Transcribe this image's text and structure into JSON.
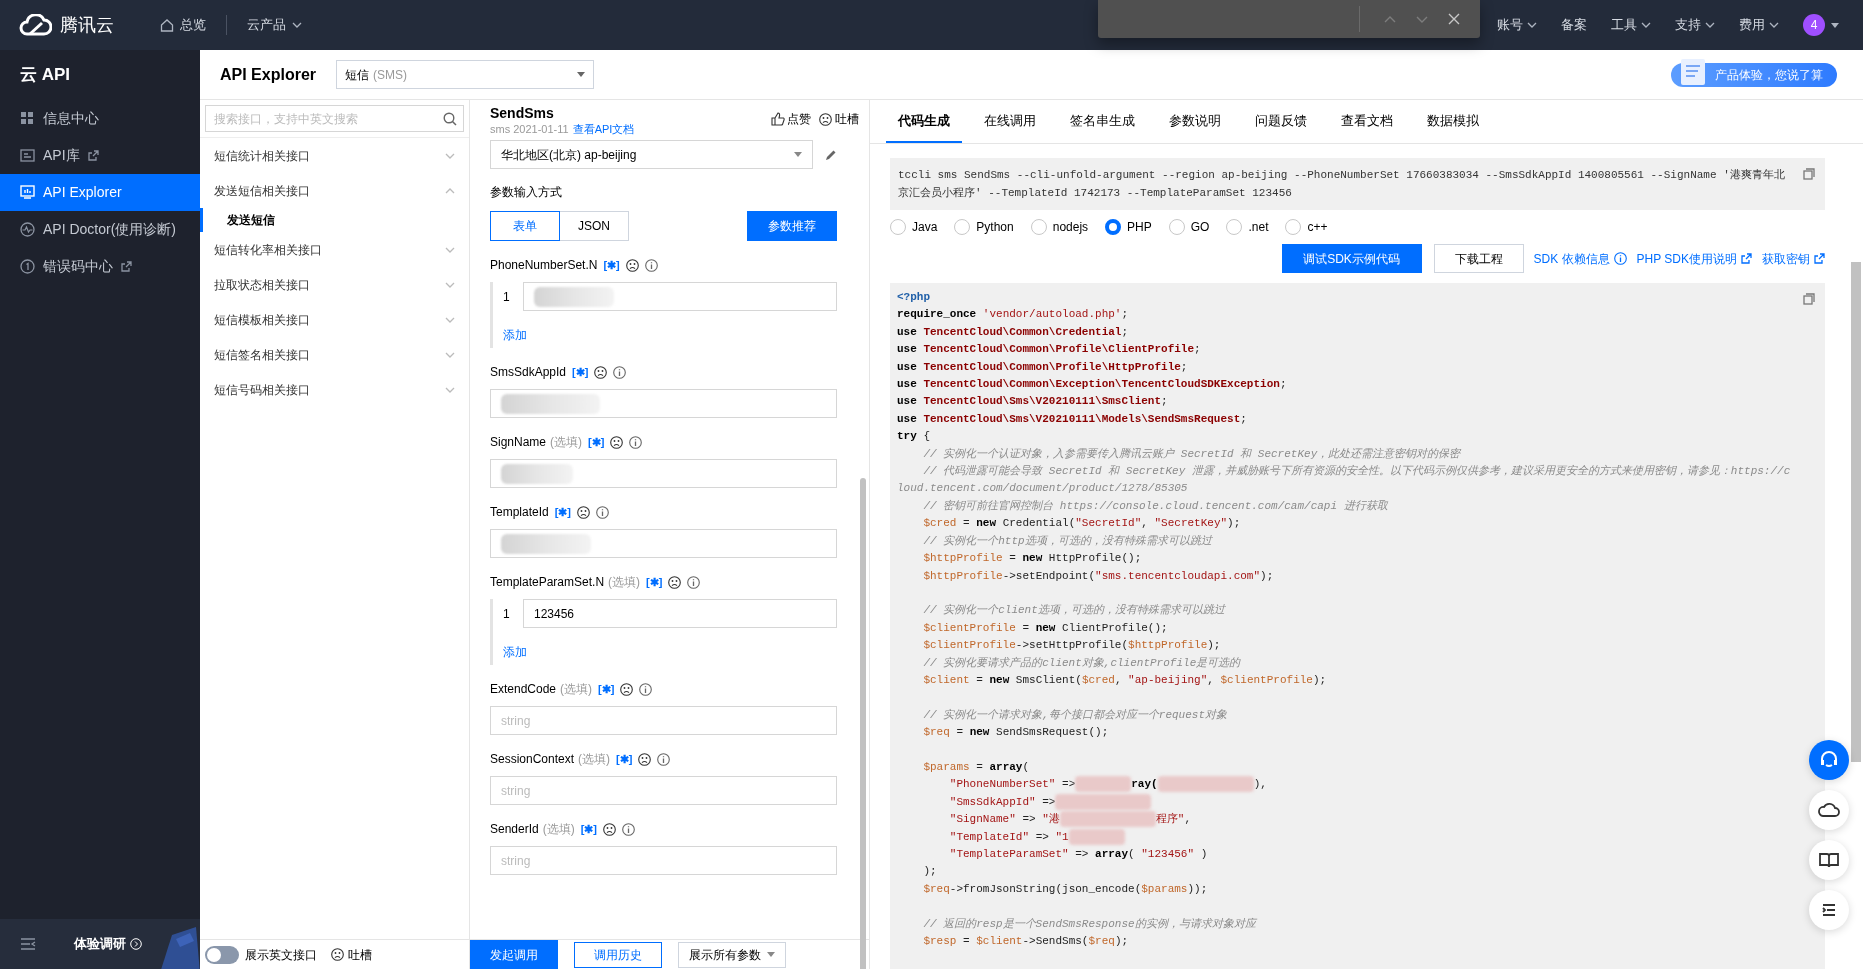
{
  "topnav": {
    "logo": "腾讯云",
    "links": [
      {
        "label": "总览",
        "kind": "home"
      },
      {
        "label": "云产品",
        "kind": "menu"
      }
    ],
    "right": [
      {
        "label": "账号",
        "kind": "menu"
      },
      {
        "label": "备案",
        "kind": "plain"
      },
      {
        "label": "工具",
        "kind": "menu"
      },
      {
        "label": "支持",
        "kind": "menu"
      },
      {
        "label": "费用",
        "kind": "menu"
      }
    ],
    "avatar": "4"
  },
  "find_bar": {
    "shown": true
  },
  "sidebar": {
    "title": "云 API",
    "items": [
      {
        "label": "信息中心",
        "external": false,
        "selected": false
      },
      {
        "label": "API库",
        "external": true,
        "selected": false
      },
      {
        "label": "API Explorer",
        "external": false,
        "selected": true
      },
      {
        "label": "API Doctor(使用诊断)",
        "external": false,
        "selected": false
      },
      {
        "label": "错误码中心",
        "external": true,
        "selected": false
      }
    ],
    "survey": "体验调研"
  },
  "header": {
    "title": "API Explorer",
    "product": "短信",
    "product_code": "(SMS)",
    "banner": "产品体验，您说了算"
  },
  "interface_list": {
    "search_placeholder": "搜索接口，支持中英文搜索",
    "groups": [
      {
        "label": "短信统计相关接口",
        "expanded": false
      },
      {
        "label": "发送短信相关接口",
        "expanded": true,
        "children": [
          {
            "label": "发送短信",
            "selected": true
          }
        ]
      },
      {
        "label": "短信转化率相关接口",
        "expanded": false
      },
      {
        "label": "拉取状态相关接口",
        "expanded": false
      },
      {
        "label": "短信模板相关接口",
        "expanded": false
      },
      {
        "label": "短信签名相关接口",
        "expanded": false
      },
      {
        "label": "短信号码相关接口",
        "expanded": false
      }
    ],
    "english_toggle": {
      "label": "展示英文接口",
      "on": false
    },
    "feedback": "吐槽"
  },
  "params": {
    "action": "SendSms",
    "meta": "sms 2021-01-11",
    "doc_link": "查看API文档",
    "like": "点赞",
    "feedback": "吐槽",
    "region": "华北地区(北京) ap-beijing",
    "input_mode_label": "参数输入方式",
    "modes": [
      {
        "label": "表单",
        "selected": true
      },
      {
        "label": "JSON",
        "selected": false
      }
    ],
    "recommend": "参数推荐",
    "fields": [
      {
        "name": "PhoneNumberSet.N",
        "kind": "list",
        "items": [
          {
            "index": "1",
            "redacted": true
          }
        ],
        "add": "添加"
      },
      {
        "name": "SmsSdkAppId",
        "kind": "text",
        "redacted": true
      },
      {
        "name": "SignName",
        "note": "(选填)",
        "kind": "text",
        "redacted": true
      },
      {
        "name": "TemplateId",
        "kind": "text",
        "redacted": true
      },
      {
        "name": "TemplateParamSet.N",
        "note": "(选填)",
        "kind": "list",
        "items": [
          {
            "index": "1",
            "value": "123456",
            "redacted": false
          }
        ],
        "add": "添加"
      },
      {
        "name": "ExtendCode",
        "note": "(选填)",
        "kind": "text",
        "placeholder": "string",
        "redacted": false
      },
      {
        "name": "SessionContext",
        "note": "(选填)",
        "kind": "text",
        "placeholder": "string",
        "redacted": false
      },
      {
        "name": "SenderId",
        "note": "(选填)",
        "kind": "text",
        "placeholder": "string",
        "redacted": false
      }
    ],
    "mark": "[✱]",
    "send": "发起调用",
    "history": "调用历史",
    "show_all": "展示所有参数"
  },
  "code_panel": {
    "tabs": [
      {
        "label": "代码生成",
        "selected": true
      },
      {
        "label": "在线调用",
        "selected": false
      },
      {
        "label": "签名串生成",
        "selected": false
      },
      {
        "label": "参数说明",
        "selected": false
      },
      {
        "label": "问题反馈",
        "selected": false
      },
      {
        "label": "查看文档",
        "selected": false
      },
      {
        "label": "数据模拟",
        "selected": false
      }
    ],
    "cli": "tccli sms SendSms --cli-unfold-argument --region ap-beijing --PhoneNumberSet 17660383034 --SmsSdkAppId 1400805561 --SignName '港爽青年北京汇会员小程序' --TemplateId 1742173 --TemplateParamSet 123456",
    "languages": [
      {
        "label": "Java",
        "selected": false
      },
      {
        "label": "Python",
        "selected": false
      },
      {
        "label": "nodejs",
        "selected": false
      },
      {
        "label": "PHP",
        "selected": true
      },
      {
        "label": "GO",
        "selected": false
      },
      {
        "label": ".net",
        "selected": false
      },
      {
        "label": "c++",
        "selected": false
      }
    ],
    "debug_button": "调试SDK示例代码",
    "download_button": "下载工程",
    "links": [
      {
        "label": "SDK 依赖信息",
        "kind": "info"
      },
      {
        "label": "PHP SDK使用说明",
        "kind": "external"
      },
      {
        "label": "获取密钥",
        "kind": "external"
      }
    ],
    "code": [
      {
        "kind": "code",
        "tokens": [
          {
            "kind": "php",
            "text": "<?php"
          }
        ]
      },
      {
        "kind": "code",
        "tokens": [
          {
            "kind": "kw",
            "text": "require_once "
          },
          {
            "kind": "str",
            "text": "'vendor/autoload.php'"
          },
          {
            "kind": "plain",
            "text": ";"
          }
        ]
      },
      {
        "kind": "code",
        "tokens": [
          {
            "kind": "kw",
            "text": "use "
          },
          {
            "kind": "cls",
            "text": "TencentCloud\\Common\\Credential"
          },
          {
            "kind": "plain",
            "text": ";"
          }
        ]
      },
      {
        "kind": "code",
        "tokens": [
          {
            "kind": "kw",
            "text": "use "
          },
          {
            "kind": "cls",
            "text": "TencentCloud\\Common\\Profile\\ClientProfile"
          },
          {
            "kind": "plain",
            "text": ";"
          }
        ]
      },
      {
        "kind": "code",
        "tokens": [
          {
            "kind": "kw",
            "text": "use "
          },
          {
            "kind": "cls",
            "text": "TencentCloud\\Common\\Profile\\HttpProfile"
          },
          {
            "kind": "plain",
            "text": ";"
          }
        ]
      },
      {
        "kind": "code",
        "tokens": [
          {
            "kind": "kw",
            "text": "use "
          },
          {
            "kind": "cls",
            "text": "TencentCloud\\Common\\Exception\\TencentCloudSDKException"
          },
          {
            "kind": "plain",
            "text": ";"
          }
        ]
      },
      {
        "kind": "code",
        "tokens": [
          {
            "kind": "kw",
            "text": "use "
          },
          {
            "kind": "cls",
            "text": "TencentCloud\\Sms\\V20210111\\SmsClient"
          },
          {
            "kind": "plain",
            "text": ";"
          }
        ]
      },
      {
        "kind": "code",
        "tokens": [
          {
            "kind": "kw",
            "text": "use "
          },
          {
            "kind": "cls",
            "text": "TencentCloud\\Sms\\V20210111\\Models\\SendSmsRequest"
          },
          {
            "kind": "plain",
            "text": ";"
          }
        ]
      },
      {
        "kind": "code",
        "tokens": [
          {
            "kind": "kw",
            "text": "try"
          },
          {
            "kind": "plain",
            "text": " {"
          }
        ]
      },
      {
        "kind": "code",
        "tokens": [
          {
            "kind": "cmt",
            "text": "    // 实例化一个认证对象，入参需要传入腾讯云账户 SecretId 和 SecretKey，此处还需注意密钥对的保密"
          }
        ]
      },
      {
        "kind": "code",
        "tokens": [
          {
            "kind": "cmt",
            "text": "    // 代码泄露可能会导致 SecretId 和 SecretKey 泄露，并威胁账号下所有资源的安全性。以下代码示例仅供参考，建议采用更安全的方式来使用密钥，请参见：https://cloud.tencent.com/document/product/1278/85305"
          }
        ]
      },
      {
        "kind": "code",
        "tokens": [
          {
            "kind": "cmt",
            "text": "    // 密钥可前往官网控制台 https://console.cloud.tencent.com/cam/capi 进行获取"
          }
        ]
      },
      {
        "kind": "code",
        "tokens": [
          {
            "kind": "var",
            "text": "    $cred"
          },
          {
            "kind": "plain",
            "text": " = "
          },
          {
            "kind": "kw",
            "text": "new"
          },
          {
            "kind": "plain",
            "text": " Credential("
          },
          {
            "kind": "str",
            "text": "\"SecretId\""
          },
          {
            "kind": "plain",
            "text": ", "
          },
          {
            "kind": "str",
            "text": "\"SecretKey\""
          },
          {
            "kind": "plain",
            "text": ");"
          }
        ]
      },
      {
        "kind": "code",
        "tokens": [
          {
            "kind": "cmt",
            "text": "    // 实例化一个http选项，可选的，没有特殊需求可以跳过"
          }
        ]
      },
      {
        "kind": "code",
        "tokens": [
          {
            "kind": "var",
            "text": "    $httpProfile"
          },
          {
            "kind": "plain",
            "text": " = "
          },
          {
            "kind": "kw",
            "text": "new"
          },
          {
            "kind": "plain",
            "text": " HttpProfile();"
          }
        ]
      },
      {
        "kind": "code",
        "tokens": [
          {
            "kind": "var",
            "text": "    $httpProfile"
          },
          {
            "kind": "plain",
            "text": "->setEndpoint("
          },
          {
            "kind": "str",
            "text": "\"sms.tencentcloudapi.com\""
          },
          {
            "kind": "plain",
            "text": ");"
          }
        ]
      },
      {
        "kind": "blank"
      },
      {
        "kind": "code",
        "tokens": [
          {
            "kind": "cmt",
            "text": "    // 实例化一个client选项，可选的，没有特殊需求可以跳过"
          }
        ]
      },
      {
        "kind": "code",
        "tokens": [
          {
            "kind": "var",
            "text": "    $clientProfile"
          },
          {
            "kind": "plain",
            "text": " = "
          },
          {
            "kind": "kw",
            "text": "new"
          },
          {
            "kind": "plain",
            "text": " ClientProfile();"
          }
        ]
      },
      {
        "kind": "code",
        "tokens": [
          {
            "kind": "var",
            "text": "    $clientProfile"
          },
          {
            "kind": "plain",
            "text": "->setHttpProfile("
          },
          {
            "kind": "var",
            "text": "$httpProfile"
          },
          {
            "kind": "plain",
            "text": ");"
          }
        ]
      },
      {
        "kind": "code",
        "tokens": [
          {
            "kind": "cmt",
            "text": "    // 实例化要请求产品的client对象,clientProfile是可选的"
          }
        ]
      },
      {
        "kind": "code",
        "tokens": [
          {
            "kind": "var",
            "text": "    $client"
          },
          {
            "kind": "plain",
            "text": " = "
          },
          {
            "kind": "kw",
            "text": "new"
          },
          {
            "kind": "plain",
            "text": " SmsClient("
          },
          {
            "kind": "var",
            "text": "$cred"
          },
          {
            "kind": "plain",
            "text": ", "
          },
          {
            "kind": "str",
            "text": "\"ap-beijing\""
          },
          {
            "kind": "plain",
            "text": ", "
          },
          {
            "kind": "var",
            "text": "$clientProfile"
          },
          {
            "kind": "plain",
            "text": ");"
          }
        ]
      },
      {
        "kind": "blank"
      },
      {
        "kind": "code",
        "tokens": [
          {
            "kind": "cmt",
            "text": "    // 实例化一个请求对象,每个接口都会对应一个request对象"
          }
        ]
      },
      {
        "kind": "code",
        "tokens": [
          {
            "kind": "var",
            "text": "    $req"
          },
          {
            "kind": "plain",
            "text": " = "
          },
          {
            "kind": "kw",
            "text": "new"
          },
          {
            "kind": "plain",
            "text": " SendSmsRequest();"
          }
        ]
      },
      {
        "kind": "blank"
      },
      {
        "kind": "code",
        "tokens": [
          {
            "kind": "var",
            "text": "    $params"
          },
          {
            "kind": "plain",
            "text": " = "
          },
          {
            "kind": "kw",
            "text": "array"
          },
          {
            "kind": "plain",
            "text": "("
          }
        ]
      },
      {
        "kind": "code",
        "tokens": [
          {
            "kind": "str",
            "text": "        \"PhoneNumberSet\""
          },
          {
            "kind": "plain",
            "text": " =>"
          },
          {
            "kind": "blur_short"
          },
          {
            "kind": "kw",
            "text": "ray("
          },
          {
            "kind": "blur_long"
          },
          {
            "kind": "plain",
            "text": "),"
          }
        ]
      },
      {
        "kind": "code",
        "tokens": [
          {
            "kind": "str",
            "text": "        \"SmsSdkAppId\""
          },
          {
            "kind": "plain",
            "text": " =>"
          },
          {
            "kind": "blur_long"
          }
        ]
      },
      {
        "kind": "code",
        "tokens": [
          {
            "kind": "str",
            "text": "        \"SignName\""
          },
          {
            "kind": "plain",
            "text": " => "
          },
          {
            "kind": "str",
            "text": "\"港"
          },
          {
            "kind": "blur_long"
          },
          {
            "kind": "str",
            "text": "程序\""
          },
          {
            "kind": "plain",
            "text": ","
          }
        ]
      },
      {
        "kind": "code",
        "tokens": [
          {
            "kind": "str",
            "text": "        \"TemplateId\""
          },
          {
            "kind": "plain",
            "text": " => "
          },
          {
            "kind": "str",
            "text": "\"1"
          },
          {
            "kind": "blur_short"
          }
        ]
      },
      {
        "kind": "code",
        "tokens": [
          {
            "kind": "str",
            "text": "        \"TemplateParamSet\""
          },
          {
            "kind": "plain",
            "text": " => "
          },
          {
            "kind": "kw",
            "text": "array"
          },
          {
            "kind": "plain",
            "text": "( "
          },
          {
            "kind": "str",
            "text": "\"123456\""
          },
          {
            "kind": "plain",
            "text": " )"
          }
        ]
      },
      {
        "kind": "code",
        "tokens": [
          {
            "kind": "plain",
            "text": "    );"
          }
        ]
      },
      {
        "kind": "code",
        "tokens": [
          {
            "kind": "var",
            "text": "    $req"
          },
          {
            "kind": "plain",
            "text": "->fromJsonString(json_encode("
          },
          {
            "kind": "var",
            "text": "$params"
          },
          {
            "kind": "plain",
            "text": "));"
          }
        ]
      },
      {
        "kind": "blank"
      },
      {
        "kind": "code",
        "tokens": [
          {
            "kind": "cmt",
            "text": "    // 返回的resp是一个SendSmsResponse的实例，与请求对象对应"
          }
        ]
      },
      {
        "kind": "code",
        "tokens": [
          {
            "kind": "var",
            "text": "    $resp"
          },
          {
            "kind": "plain",
            "text": " = "
          },
          {
            "kind": "var",
            "text": "$client"
          },
          {
            "kind": "plain",
            "text": "->SendSms("
          },
          {
            "kind": "var",
            "text": "$req"
          },
          {
            "kind": "plain",
            "text": ");"
          }
        ]
      }
    ]
  },
  "float_buttons": [
    {
      "primary": true
    },
    {
      "primary": false
    },
    {
      "primary": false
    },
    {
      "primary": false
    }
  ]
}
